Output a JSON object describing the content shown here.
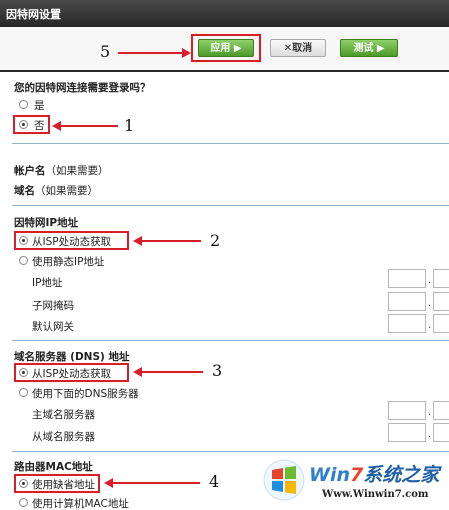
{
  "header": {
    "title": "因特网设置"
  },
  "toolbar": {
    "apply_label": "应用 ▶",
    "cancel_label": "✕取消",
    "test_label": "测试 ▶"
  },
  "question": "您的因特网连接需要登录吗？",
  "login_options": [
    {
      "label": "是",
      "selected": false
    },
    {
      "label": "否",
      "selected": true
    }
  ],
  "account": {
    "name_label": "帐户名",
    "name_hint": "（如果需要）",
    "domain_label": "域名",
    "domain_hint": "（如果需要）"
  },
  "ip_section": {
    "title": "因特网IP地址",
    "options": [
      {
        "label": "从ISP处动态获取",
        "selected": true
      },
      {
        "label": "使用静态IP地址",
        "selected": false
      }
    ],
    "fields": [
      "IP地址",
      "子网掩码",
      "默认网关"
    ]
  },
  "dns_section": {
    "title": "域名服务器 (DNS) 地址",
    "options": [
      {
        "label": "从ISP处动态获取",
        "selected": true
      },
      {
        "label": "使用下面的DNS服务器",
        "selected": false
      }
    ],
    "fields": [
      "主域名服务器",
      "从域名服务器"
    ]
  },
  "mac_section": {
    "title": "路由器MAC地址",
    "options": [
      {
        "label": "使用缺省地址",
        "selected": true
      },
      {
        "label": "使用计算机MAC地址",
        "selected": false
      }
    ]
  },
  "annotations": {
    "n1": "1",
    "n2": "2",
    "n3": "3",
    "n4": "4",
    "n5": "5"
  },
  "watermark": {
    "brand_a": "Win",
    "brand_b": "7",
    "brand_c": "系统之家",
    "url": "Www.Winwin7.com"
  },
  "colors": {
    "accent_red": "#d81e2a",
    "apply_green": "#5aa832",
    "separator": "#8fb7c9"
  }
}
